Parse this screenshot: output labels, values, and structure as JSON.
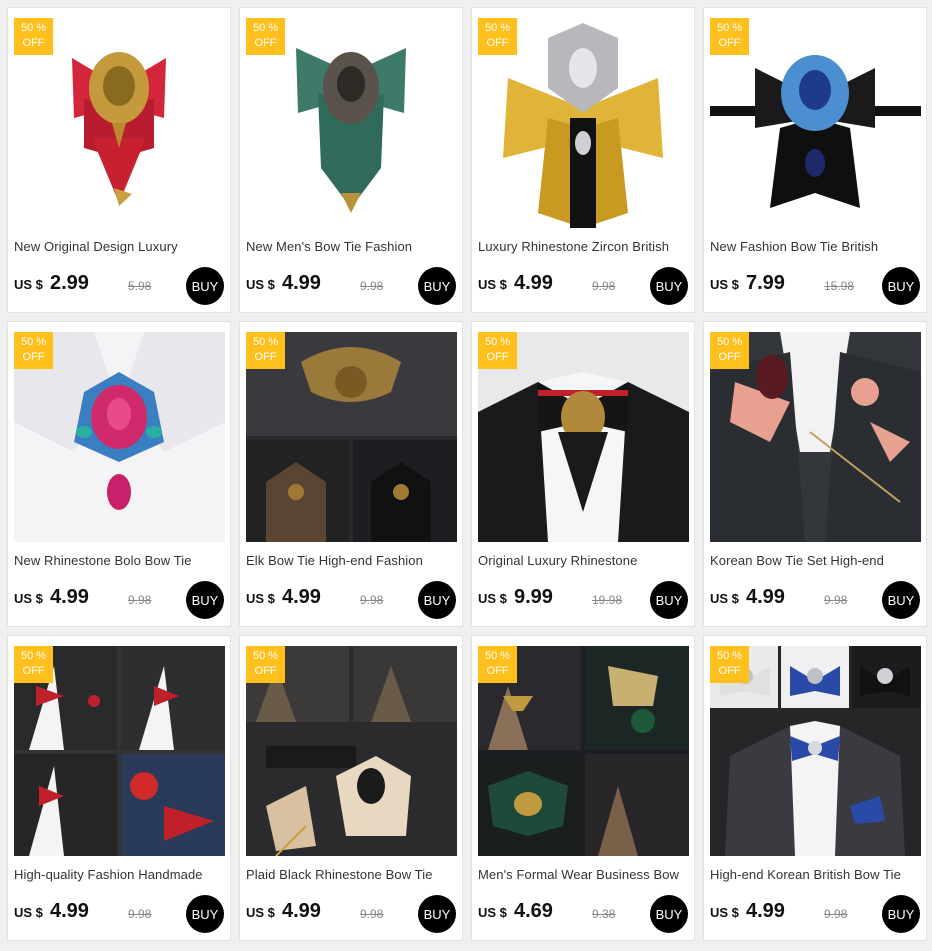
{
  "badge": {
    "top": "50 %",
    "bottom": "OFF"
  },
  "currency": "US $",
  "buy_label": "BUY",
  "colors": {
    "badge": "#ffbf1c",
    "buy": "#000000"
  },
  "products": [
    {
      "title": "New Original Design Luxury",
      "price": "2.99",
      "old": "5.98",
      "image": "red-bow-tie-gold-brooch"
    },
    {
      "title": "New Men's Bow Tie Fashion",
      "price": "4.99",
      "old": "9.98",
      "image": "green-bow-tie-rhinestone"
    },
    {
      "title": "Luxury Rhinestone Zircon British",
      "price": "4.99",
      "old": "9.98",
      "image": "gold-black-bow-tie-crystal"
    },
    {
      "title": "New Fashion Bow Tie British",
      "price": "7.99",
      "old": "15.98",
      "image": "black-bow-tie-blue-crystal"
    },
    {
      "title": "New Rhinestone Bolo Bow Tie",
      "price": "4.99",
      "old": "9.98",
      "image": "pink-rhinestone-brooch-shirt"
    },
    {
      "title": "Elk Bow Tie High-end Fashion",
      "price": "4.99",
      "old": "9.98",
      "image": "elk-bronze-brooch-collage"
    },
    {
      "title": "Original Luxury Rhinestone",
      "price": "9.99",
      "old": "19.98",
      "image": "black-red-bow-tie-suit"
    },
    {
      "title": "Korean Bow Tie Set High-end",
      "price": "4.99",
      "old": "9.98",
      "image": "pink-bow-tie-set-suit"
    },
    {
      "title": "High-quality Fashion Handmade",
      "price": "4.99",
      "old": "9.98",
      "image": "red-bow-tie-set-collage"
    },
    {
      "title": "Plaid Black Rhinestone Bow Tie",
      "price": "4.99",
      "old": "9.98",
      "image": "beige-bow-tie-set-collage"
    },
    {
      "title": "Men's Formal Wear Business Bow",
      "price": "4.69",
      "old": "9.38",
      "image": "green-gold-bow-tie-collage"
    },
    {
      "title": "High-end Korean British Bow Tie",
      "price": "4.99",
      "old": "9.98",
      "image": "blue-rhinestone-bow-tie-collage"
    }
  ]
}
